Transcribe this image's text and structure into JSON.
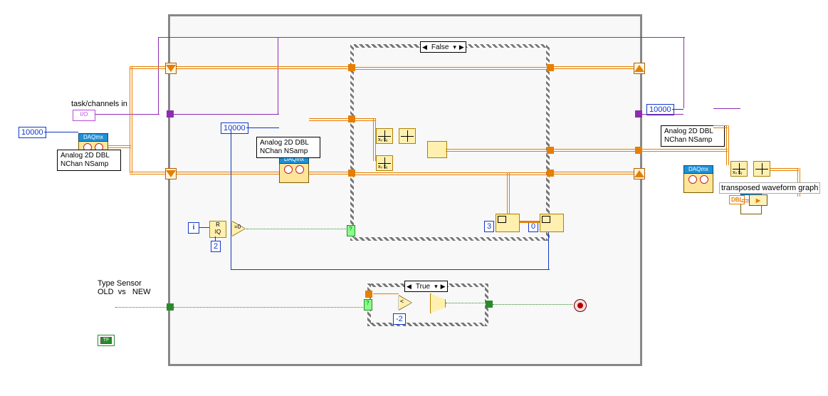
{
  "labels": {
    "task_channels": "task/channels in",
    "type_sensor": "Type Sensor\nOLD  vs   NEW",
    "transposed_graph": "transposed waveform graph"
  },
  "constants": {
    "ten_thousand_1": "10000",
    "ten_thousand_2": "10000",
    "ten_thousand_3": "10000",
    "two": "2",
    "three": "3",
    "zero": "0",
    "neg_two": "-2"
  },
  "nodes": {
    "daqmx_header": "DAQmx",
    "daqmx_mode": "Analog 2D DBL NChan NSamp",
    "io_text": "I/O",
    "bool_tf": "TF",
    "iq_label": "IQ",
    "r_label": "R",
    "dbl_label": "DBL",
    "i_term": "i"
  },
  "case": {
    "false_sel": "False",
    "true_sel": "True",
    "dropdown_glyph": "▾",
    "left_arrow": "◀",
    "right_arrow": "▶"
  },
  "idx_labels": {
    "xii": "xᵢᵢ xᵢⱼ"
  }
}
